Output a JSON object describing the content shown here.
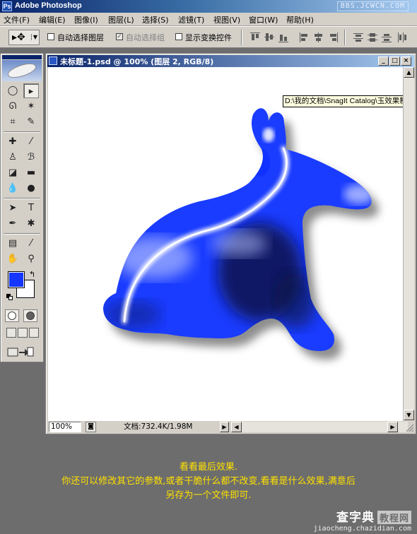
{
  "app": {
    "title": "Adobe Photoshop",
    "watermark": "BBS.JCWCN.COM"
  },
  "menu": [
    "文件(F)",
    "编辑(E)",
    "图像(I)",
    "图层(L)",
    "选择(S)",
    "滤镜(T)",
    "视图(V)",
    "窗口(W)",
    "帮助(H)"
  ],
  "options": {
    "auto_select_layer": "自动选择图层",
    "auto_select_group": "自动选择组",
    "show_transform": "显示变换控件",
    "auto_select_layer_checked": false,
    "auto_select_group_checked": true,
    "show_transform_checked": false
  },
  "toolbox": {
    "foreground_color": "#1436ff",
    "background_color": "#ffffff"
  },
  "document": {
    "title": "未标题-1.psd @ 100% (图层 2, RGB/8)",
    "tooltip": "D:\\我的文档\\SnagIt Catalog\\玉效果制",
    "zoom": "100%",
    "doc_info": "文档:732.4K/1.98M",
    "rabbit_color": "#1a3cff"
  },
  "caption": {
    "line1": "看看最后效果.",
    "line2": "你还可以修改其它的参数,或者干脆什么都不改变,看看是什么效果,满意后",
    "line3": "另存为一个文件即可."
  },
  "footer": {
    "site": "查字典",
    "tag": "教程网",
    "url": "jiaocheng.chazidian.com"
  }
}
